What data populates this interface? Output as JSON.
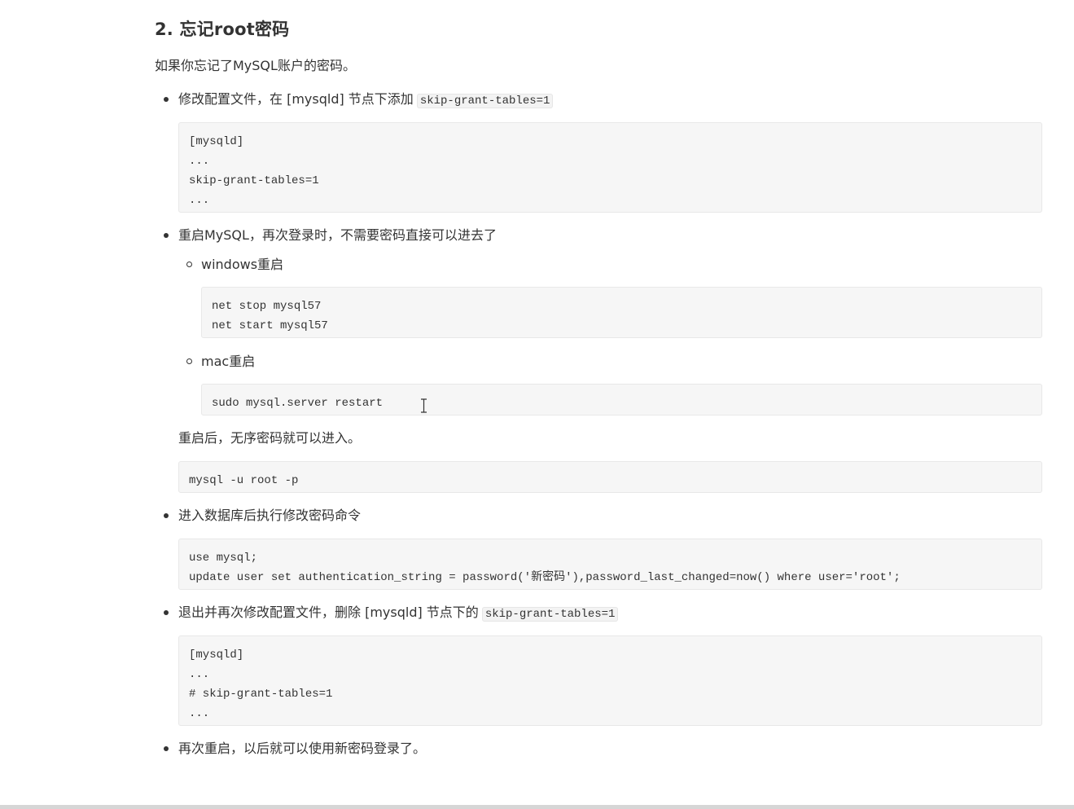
{
  "heading": "2. 忘记root密码",
  "intro": "如果你忘记了MySQL账户的密码。",
  "step1": {
    "text": "修改配置文件，在 [mysqld] 节点下添加",
    "code_inline": "skip-grant-tables=1",
    "code_lines": [
      "[mysqld]",
      "...",
      "skip-grant-tables=1",
      "..."
    ]
  },
  "step2": {
    "text": "重启MySQL，再次登录时，不需要密码直接可以进去了",
    "windows": {
      "label": "windows重启",
      "code_lines": [
        "net stop mysql57",
        "net start mysql57"
      ]
    },
    "mac": {
      "label": "mac重启",
      "code_lines": [
        "sudo mysql.server restart"
      ]
    },
    "after_text": "重启后，无序密码就可以进入。",
    "login_code": [
      "mysql -u root -p"
    ]
  },
  "step3": {
    "text": "进入数据库后执行修改密码命令",
    "code_lines": [
      "use mysql;",
      "update user set authentication_string = password('新密码'),password_last_changed=now() where user='root';"
    ]
  },
  "step4": {
    "text": "退出并再次修改配置文件，删除 [mysqld] 节点下的",
    "code_inline": "skip-grant-tables=1",
    "code_lines": [
      "[mysqld]",
      "...",
      "# skip-grant-tables=1",
      "..."
    ]
  },
  "step5": {
    "text": "再次重启，以后就可以使用新密码登录了。"
  },
  "colors": {
    "text": "#333333",
    "code_bg": "#f6f6f6",
    "code_border": "#e8e8e8"
  }
}
